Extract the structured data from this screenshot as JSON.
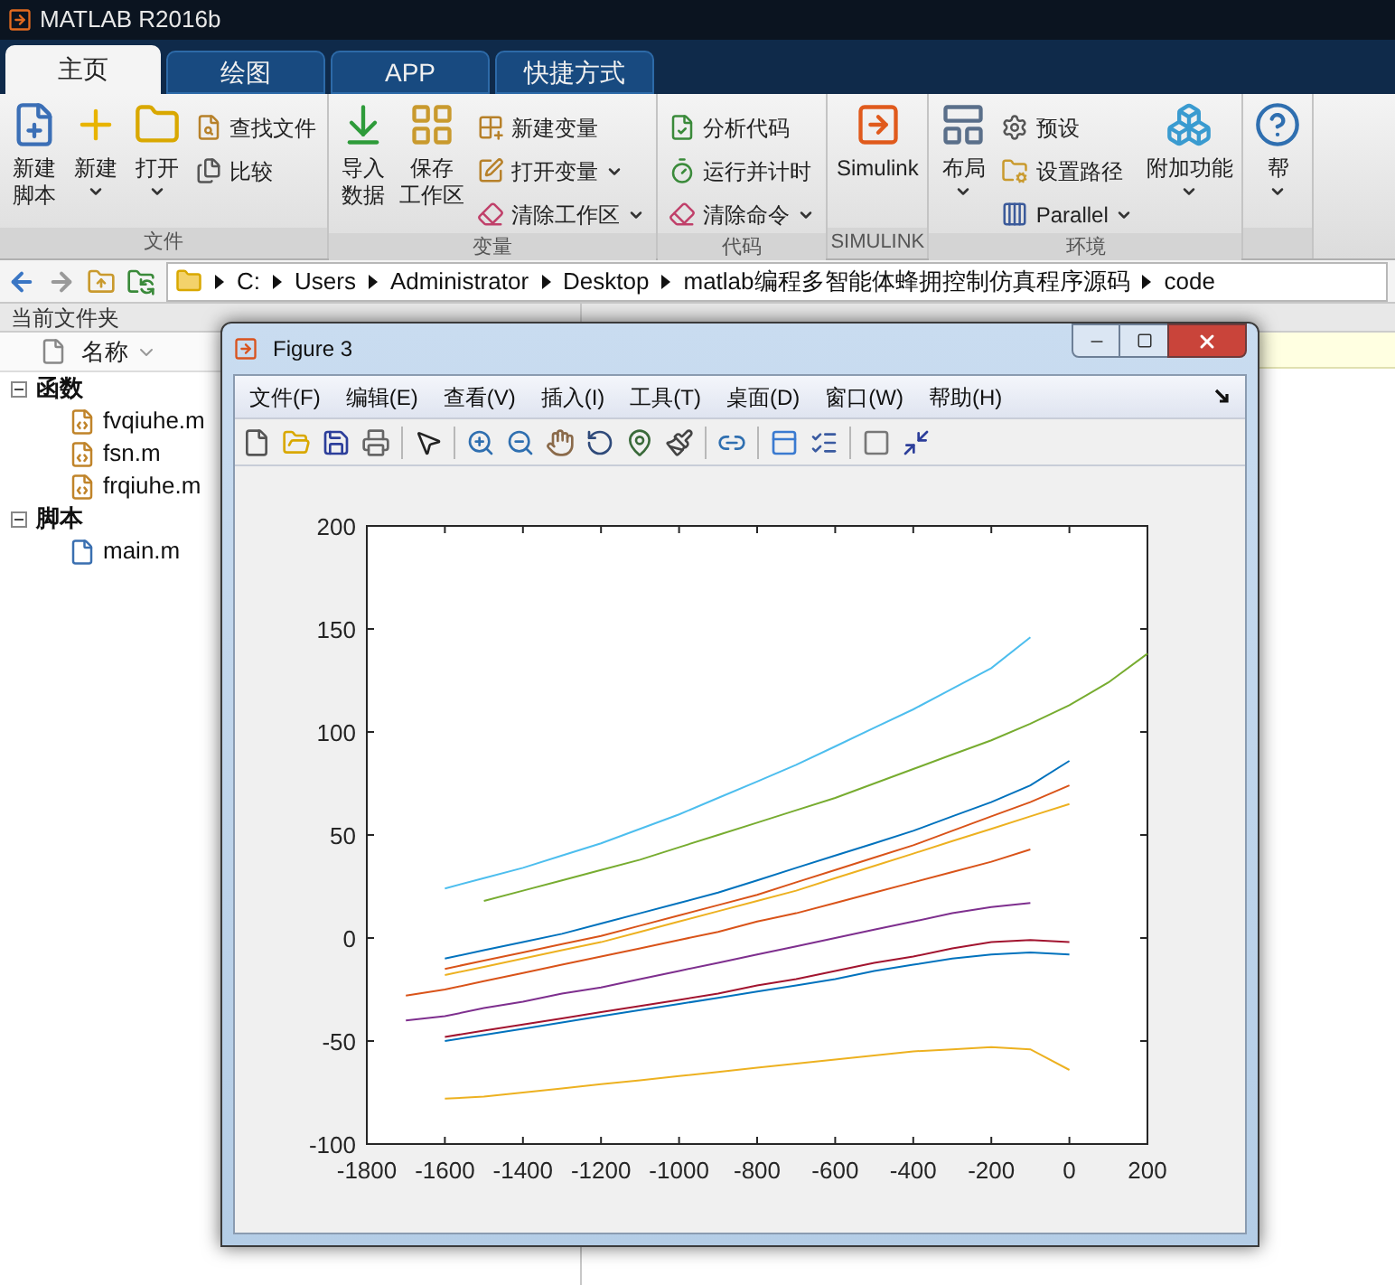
{
  "app": {
    "title": "MATLAB R2016b"
  },
  "tabs": [
    {
      "label": "主页",
      "selected": true
    },
    {
      "label": "绘图",
      "selected": false
    },
    {
      "label": "APP",
      "selected": false
    },
    {
      "label": "快捷方式",
      "selected": false
    }
  ],
  "toolstrip": [
    {
      "label": "文件",
      "items": [
        {
          "kind": "big",
          "lines": [
            "新建",
            "脚本"
          ],
          "dropdown": false
        },
        {
          "kind": "big",
          "lines": [
            "新建"
          ],
          "dropdown": true
        },
        {
          "kind": "big",
          "lines": [
            "打开"
          ],
          "dropdown": true
        },
        {
          "kind": "small",
          "label": "查找文件",
          "dropdown": false
        },
        {
          "kind": "small",
          "label": "比较",
          "dropdown": false
        }
      ]
    },
    {
      "label": "变量",
      "items": [
        {
          "kind": "big",
          "lines": [
            "导入",
            "数据"
          ],
          "dropdown": false
        },
        {
          "kind": "big",
          "lines": [
            "保存",
            "工作区"
          ],
          "dropdown": false
        },
        {
          "kind": "small",
          "label": "新建变量",
          "dropdown": false
        },
        {
          "kind": "small",
          "label": "打开变量",
          "dropdown": true
        },
        {
          "kind": "small",
          "label": "清除工作区",
          "dropdown": true
        }
      ]
    },
    {
      "label": "代码",
      "items": [
        {
          "kind": "small",
          "label": "分析代码",
          "dropdown": false
        },
        {
          "kind": "small",
          "label": "运行并计时",
          "dropdown": false
        },
        {
          "kind": "small",
          "label": "清除命令",
          "dropdown": true
        }
      ]
    },
    {
      "label": "SIMULINK",
      "items": [
        {
          "kind": "big",
          "lines": [
            "Simulink"
          ],
          "dropdown": false
        }
      ]
    },
    {
      "label": "环境",
      "items": [
        {
          "kind": "big",
          "lines": [
            "布局"
          ],
          "dropdown": true
        },
        {
          "kind": "small",
          "label": "预设",
          "dropdown": false
        },
        {
          "kind": "small",
          "label": "设置路径",
          "dropdown": false
        },
        {
          "kind": "small",
          "label": "Parallel",
          "dropdown": true
        },
        {
          "kind": "big",
          "lines": [
            "附加功能"
          ],
          "dropdown": true
        }
      ]
    },
    {
      "items": [
        {
          "kind": "big",
          "lines": [
            "帮"
          ],
          "dropdown": true
        }
      ]
    }
  ],
  "path": [
    "C:",
    "Users",
    "Administrator",
    "Desktop",
    "matlab编程多智能体蜂拥控制仿真程序源码",
    "code"
  ],
  "current_folder": {
    "title": "当前文件夹",
    "column": "名称",
    "groups": [
      {
        "label": "函数",
        "expanded": true,
        "children": [
          {
            "label": "fvqiuhe.m",
            "kind": "function"
          },
          {
            "label": "fsn.m",
            "kind": "function"
          },
          {
            "label": "frqiuhe.m",
            "kind": "function"
          }
        ]
      },
      {
        "label": "脚本",
        "expanded": true,
        "children": [
          {
            "label": "main.m",
            "kind": "script"
          }
        ]
      }
    ]
  },
  "figure": {
    "title": "Figure 3",
    "menu": [
      "文件(F)",
      "编辑(E)",
      "查看(V)",
      "插入(I)",
      "工具(T)",
      "桌面(D)",
      "窗口(W)",
      "帮助(H)"
    ],
    "chart_data": {
      "type": "line",
      "x": [
        -1700,
        -1600,
        -1500,
        -1400,
        -1300,
        -1200,
        -1100,
        -1000,
        -900,
        -800,
        -700,
        -600,
        -500,
        -400,
        -300,
        -200,
        -100,
        0,
        100,
        200
      ],
      "xlim": [
        -1800,
        200
      ],
      "ylim": [
        -100,
        200
      ],
      "xticks": [
        -1800,
        -1600,
        -1400,
        -1200,
        -1000,
        -800,
        -600,
        -400,
        -200,
        0,
        200
      ],
      "yticks": [
        -100,
        -50,
        0,
        50,
        100,
        150,
        200
      ],
      "series": [
        {
          "color": "#4dbeee",
          "values": [
            null,
            24,
            29,
            34,
            40,
            46,
            53,
            60,
            68,
            76,
            84,
            93,
            102,
            111,
            121,
            131,
            146,
            null,
            null,
            null
          ]
        },
        {
          "color": "#77ac30",
          "values": [
            null,
            null,
            18,
            23,
            28,
            33,
            38,
            44,
            50,
            56,
            62,
            68,
            75,
            82,
            89,
            96,
            104,
            113,
            124,
            138
          ]
        },
        {
          "color": "#0072bd",
          "values": [
            null,
            -10,
            -6,
            -2,
            2,
            7,
            12,
            17,
            22,
            28,
            34,
            40,
            46,
            52,
            59,
            66,
            74,
            86,
            null,
            null
          ]
        },
        {
          "color": "#d95319",
          "values": [
            null,
            -15,
            -11,
            -7,
            -3,
            1,
            6,
            11,
            16,
            21,
            27,
            33,
            39,
            45,
            52,
            59,
            66,
            74,
            null,
            null
          ]
        },
        {
          "color": "#edb120",
          "values": [
            null,
            -18,
            -14,
            -10,
            -6,
            -2,
            3,
            8,
            13,
            18,
            23,
            29,
            35,
            41,
            47,
            53,
            59,
            65,
            null,
            null
          ]
        },
        {
          "color": "#d95319",
          "values": [
            -28,
            -25,
            -21,
            -17,
            -13,
            -9,
            -5,
            -1,
            3,
            8,
            12,
            17,
            22,
            27,
            32,
            37,
            43,
            null,
            null,
            null
          ]
        },
        {
          "color": "#7e2f8e",
          "values": [
            -40,
            -38,
            -34,
            -31,
            -27,
            -24,
            -20,
            -16,
            -12,
            -8,
            -4,
            0,
            4,
            8,
            12,
            15,
            17,
            null,
            null,
            null
          ]
        },
        {
          "color": "#a2142f",
          "values": [
            null,
            -48,
            -45,
            -42,
            -39,
            -36,
            -33,
            -30,
            -27,
            -23,
            -20,
            -16,
            -12,
            -9,
            -5,
            -2,
            -1,
            -2,
            null,
            null
          ]
        },
        {
          "color": "#0072bd",
          "values": [
            null,
            -50,
            -47,
            -44,
            -41,
            -38,
            -35,
            -32,
            -29,
            -26,
            -23,
            -20,
            -16,
            -13,
            -10,
            -8,
            -7,
            -8,
            null,
            null
          ]
        },
        {
          "color": "#edb120",
          "values": [
            null,
            -78,
            -77,
            -75,
            -73,
            -71,
            -69,
            -67,
            -65,
            -63,
            -61,
            -59,
            -57,
            -55,
            -54,
            -53,
            -54,
            -64,
            null,
            null
          ]
        }
      ]
    }
  }
}
